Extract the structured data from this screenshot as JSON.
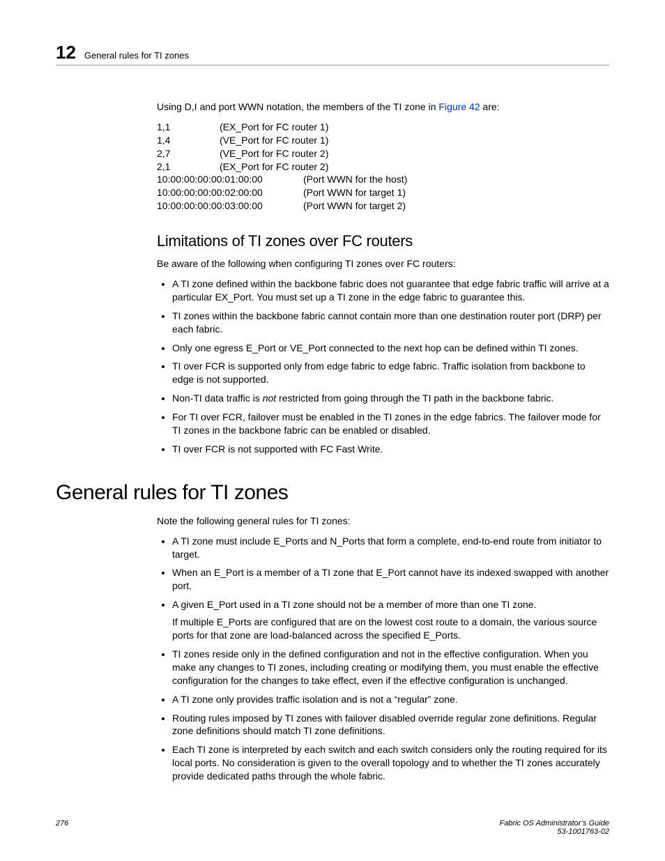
{
  "header": {
    "chapter_number": "12",
    "running_title": "General rules for TI zones"
  },
  "intro_sentence_pre": "Using D,I and port WWN notation, the members of the TI zone in ",
  "intro_sentence_link": "Figure 42",
  "intro_sentence_post": " are:",
  "notation_short": [
    {
      "di": "1,1",
      "desc": "(EX_Port for FC router 1)"
    },
    {
      "di": "1,4",
      "desc": "(VE_Port for FC router 1)"
    },
    {
      "di": "2,7",
      "desc": "(VE_Port for FC router 2)"
    },
    {
      "di": "2,1",
      "desc": "(EX_Port for FC router 2)"
    }
  ],
  "notation_wwn": [
    {
      "wwn": "10:00:00:00:00:01:00:00",
      "desc": "(Port WWN for the host)"
    },
    {
      "wwn": "10:00:00:00:00:02:00:00",
      "desc": "(Port WWN for target 1)"
    },
    {
      "wwn": "10:00:00:00:00:03:00:00",
      "desc": "(Port WWN for target 2)"
    }
  ],
  "limitations": {
    "heading": "Limitations of TI zones over FC routers",
    "lead": "Be aware of the following when configuring TI zones over FC routers:",
    "items": [
      "A TI zone defined within the backbone fabric does not guarantee that edge fabric traffic will arrive at a particular EX_Port. You must set up a TI zone in the edge fabric to guarantee this.",
      "TI zones within the backbone fabric cannot contain more than one destination router port (DRP) per each fabric.",
      "Only one egress E_Port or VE_Port connected to the next hop can be defined within TI zones.",
      "TI over FCR is supported only from edge fabric to edge fabric. Traffic isolation from backbone to edge is not supported.",
      "__NOT_ITEM__",
      "For TI over FCR, failover must be enabled in the TI zones in the edge fabrics. The failover mode for TI zones in the backbone fabric can be enabled or disabled.",
      "TI over FCR is not supported with FC Fast Write."
    ],
    "not_item_pre": "Non-TI data traffic is ",
    "not_item_em": "not",
    "not_item_post": " restricted from going through the TI path in the backbone fabric."
  },
  "general": {
    "heading": "General rules for TI zones",
    "lead": "Note the following general rules for TI zones:",
    "items": [
      "A TI zone must include E_Ports and N_Ports that form a complete, end-to-end route from initiator to target.",
      "When an E_Port is a member of a TI zone that E_Port cannot have its indexed swapped with another port.",
      "__EPORT_ITEM__",
      "TI zones reside only in the defined configuration and not in the effective configuration. When you make any changes to TI zones, including creating or modifying them, you must enable the effective configuration for the changes to take effect, even if the effective configuration is unchanged.",
      "A TI zone only provides traffic isolation and is not a “regular” zone.",
      "Routing rules imposed by TI zones with failover disabled override regular zone definitions. Regular zone definitions should match TI zone definitions.",
      "Each TI zone is interpreted by each switch and each switch considers only the routing required for its local ports. No consideration is given to the overall topology and to whether the TI zones accurately provide dedicated paths through the whole fabric."
    ],
    "eport_item_main": "A given E_Port used in a TI zone should not be a member of more than one TI zone.",
    "eport_item_sub": "If multiple E_Ports are configured that are on the lowest cost route to a domain, the various source ports for that zone are load-balanced across the specified E_Ports."
  },
  "footer": {
    "page_number": "276",
    "doc_title": "Fabric OS Administrator’s Guide",
    "doc_id": "53-1001763-02"
  }
}
